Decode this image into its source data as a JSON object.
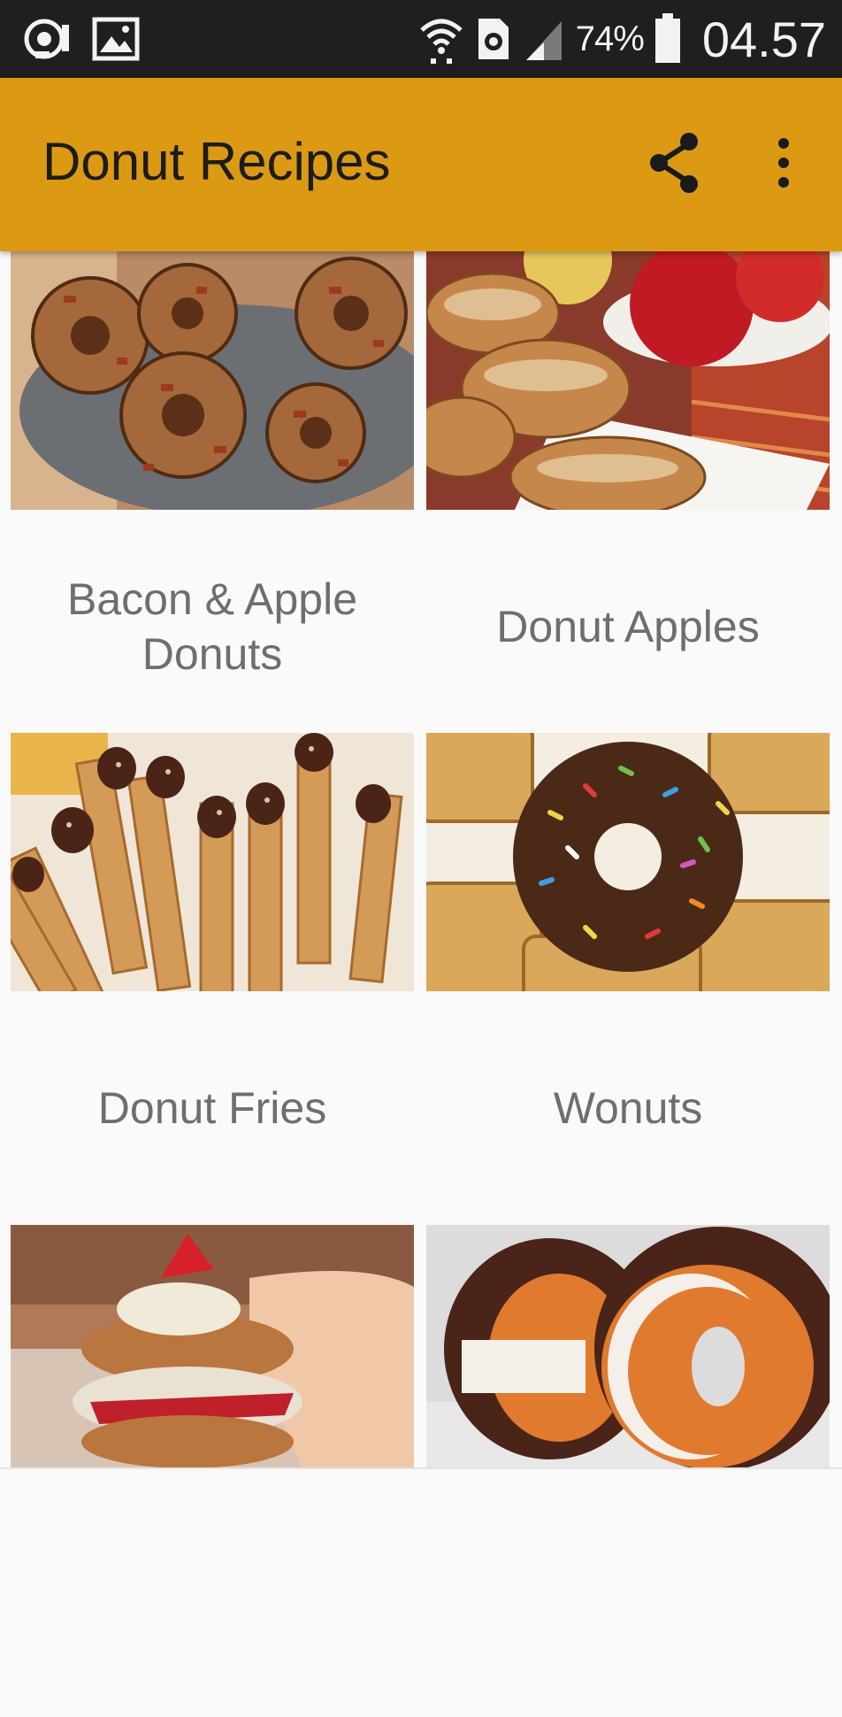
{
  "status_bar": {
    "left_icons": [
      "hotspot-icon",
      "image-icon"
    ],
    "right_icons": [
      "wifi-icon",
      "data-saver-icon",
      "cell-signal-icon",
      "battery-icon"
    ],
    "battery": "74%",
    "time": "04.57"
  },
  "app_bar": {
    "title": "Donut Recipes",
    "actions": [
      "share-icon",
      "more-vert-icon"
    ],
    "color": "#dc9a14"
  },
  "recipes": [
    {
      "title": "Bacon & Apple Donuts",
      "image": "bacon-apple-donuts-photo"
    },
    {
      "title": "Donut Apples",
      "image": "donut-apples-photo"
    },
    {
      "title": "Donut Fries",
      "image": "donut-fries-photo"
    },
    {
      "title": "Wonuts",
      "image": "wonuts-photo"
    },
    {
      "title": "",
      "image": "donut-shortcake-photo"
    },
    {
      "title": "",
      "image": "ice-cream-donut-sandwich-photo"
    }
  ]
}
